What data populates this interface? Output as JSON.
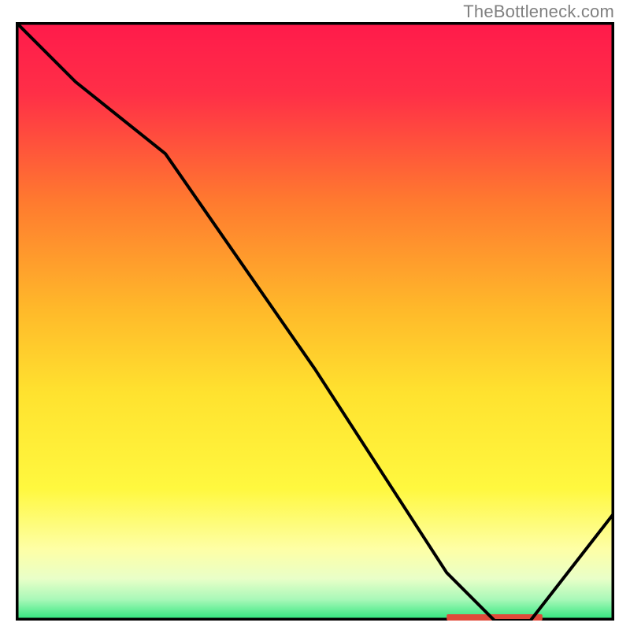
{
  "attribution": "TheBottleneck.com",
  "chart_data": {
    "type": "line",
    "title": "",
    "xlabel": "",
    "ylabel": "",
    "xlim": [
      0,
      100
    ],
    "ylim": [
      0,
      100
    ],
    "series": [
      {
        "name": "curve",
        "x": [
          0,
          10,
          25,
          50,
          72,
          80,
          86,
          100
        ],
        "y": [
          100,
          90,
          78,
          42,
          8,
          0,
          0,
          18
        ]
      }
    ],
    "optimum_band": {
      "x_start": 72,
      "x_end": 88,
      "y": 0
    },
    "background_gradient": {
      "stops": [
        {
          "offset": 0.0,
          "color": "#ff1a4b"
        },
        {
          "offset": 0.12,
          "color": "#ff2f47"
        },
        {
          "offset": 0.3,
          "color": "#ff7a2f"
        },
        {
          "offset": 0.48,
          "color": "#ffb92a"
        },
        {
          "offset": 0.62,
          "color": "#ffe22f"
        },
        {
          "offset": 0.78,
          "color": "#fff83f"
        },
        {
          "offset": 0.88,
          "color": "#feffa5"
        },
        {
          "offset": 0.93,
          "color": "#e9ffc8"
        },
        {
          "offset": 0.965,
          "color": "#a8f8b8"
        },
        {
          "offset": 1.0,
          "color": "#28e57a"
        }
      ]
    },
    "frame_color": "#000000",
    "line_color": "#000000",
    "optimum_color": "#e04a3a"
  }
}
